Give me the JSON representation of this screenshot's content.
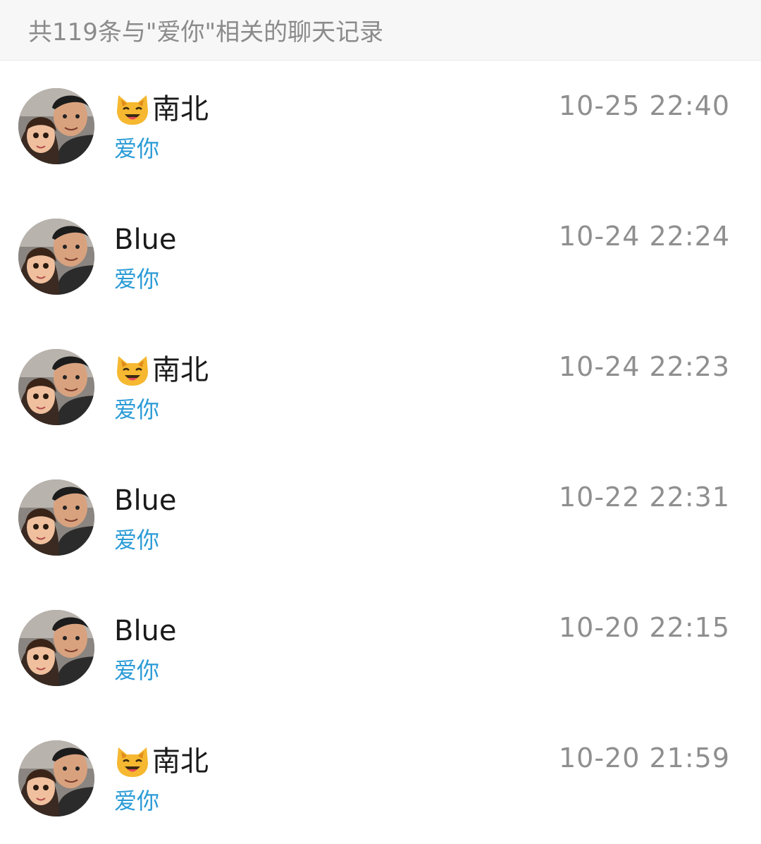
{
  "header": {
    "summary": "共119条与\"爱你\"相关的聊天记录"
  },
  "results": [
    {
      "sender": "南北",
      "sender_icon": "smiling-cat-icon",
      "message": "爱你",
      "time": "10-25 22:40"
    },
    {
      "sender": "Blue",
      "sender_icon": "",
      "message": "爱你",
      "time": "10-24 22:24"
    },
    {
      "sender": "南北",
      "sender_icon": "smiling-cat-icon",
      "message": "爱你",
      "time": "10-24 22:23"
    },
    {
      "sender": "Blue",
      "sender_icon": "",
      "message": "爱你",
      "time": "10-22 22:31"
    },
    {
      "sender": "Blue",
      "sender_icon": "",
      "message": "爱你",
      "time": "10-20 22:15"
    },
    {
      "sender": "南北",
      "sender_icon": "smiling-cat-icon",
      "message": "爱你",
      "time": "10-20 21:59"
    }
  ],
  "colors": {
    "highlight": "#2a9bd6",
    "header_bg": "#f7f7f7",
    "muted_text": "#8f8f8f"
  }
}
